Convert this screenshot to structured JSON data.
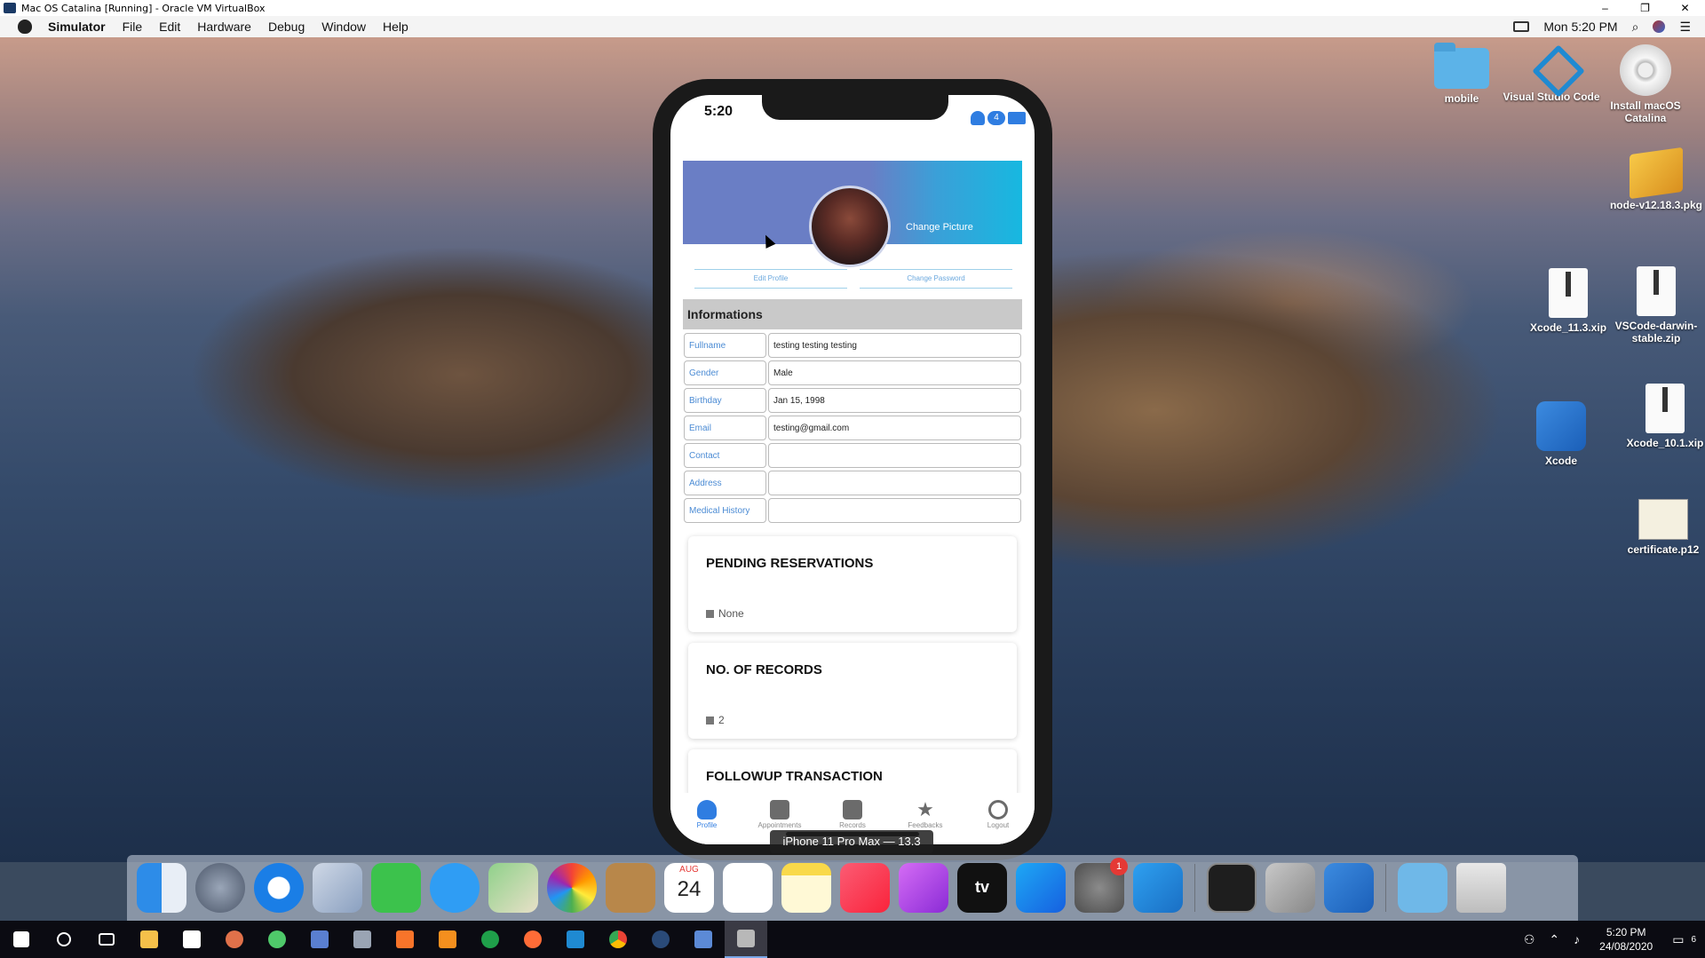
{
  "vbox": {
    "title": "Mac OS Catalina [Running] - Oracle VM VirtualBox",
    "controls": [
      "–",
      "❐",
      "✕"
    ]
  },
  "menubar": {
    "items": [
      "Simulator",
      "File",
      "Edit",
      "Hardware",
      "Debug",
      "Window",
      "Help"
    ],
    "clock": "Mon 5:20 PM"
  },
  "desktop_icons": [
    "mobile",
    "Visual Studio Code",
    "Install macOS Catalina",
    "node-v12.18.3.pkg",
    "Xcode_11.3.xip",
    "VSCode-darwin-stable.zip",
    "Xcode",
    "Xcode_10.1.xip",
    "certificate.p12"
  ],
  "phone": {
    "time": "5:20",
    "notification_count": "4",
    "change_picture": "Change Picture",
    "edit_profile": "Edit Profile",
    "change_password": "Change Password",
    "info_heading": "Informations",
    "fields": [
      {
        "label": "Fullname",
        "value": "testing testing testing"
      },
      {
        "label": "Gender",
        "value": "Male"
      },
      {
        "label": "Birthday",
        "value": "Jan 15, 1998"
      },
      {
        "label": "Email",
        "value": "testing@gmail.com"
      },
      {
        "label": "Contact",
        "value": ""
      },
      {
        "label": "Address",
        "value": ""
      },
      {
        "label": "Medical History",
        "value": ""
      }
    ],
    "cards": [
      {
        "title": "PENDING RESERVATIONS",
        "value": "None"
      },
      {
        "title": "NO. OF RECORDS",
        "value": "2"
      },
      {
        "title": "FOLLOWUP TRANSACTION",
        "value": ""
      }
    ],
    "tabs": [
      "Profile",
      "Appointments",
      "Records",
      "Feedbacks",
      "Logout"
    ]
  },
  "device_label": "iPhone 11 Pro Max — 13.3",
  "dock": {
    "calendar_month": "AUG",
    "calendar_day": "24",
    "prefs_badge": "1",
    "tv_label": "tv"
  },
  "taskbar": {
    "time": "5:20 PM",
    "date": "24/08/2020",
    "notification_count": "6"
  }
}
